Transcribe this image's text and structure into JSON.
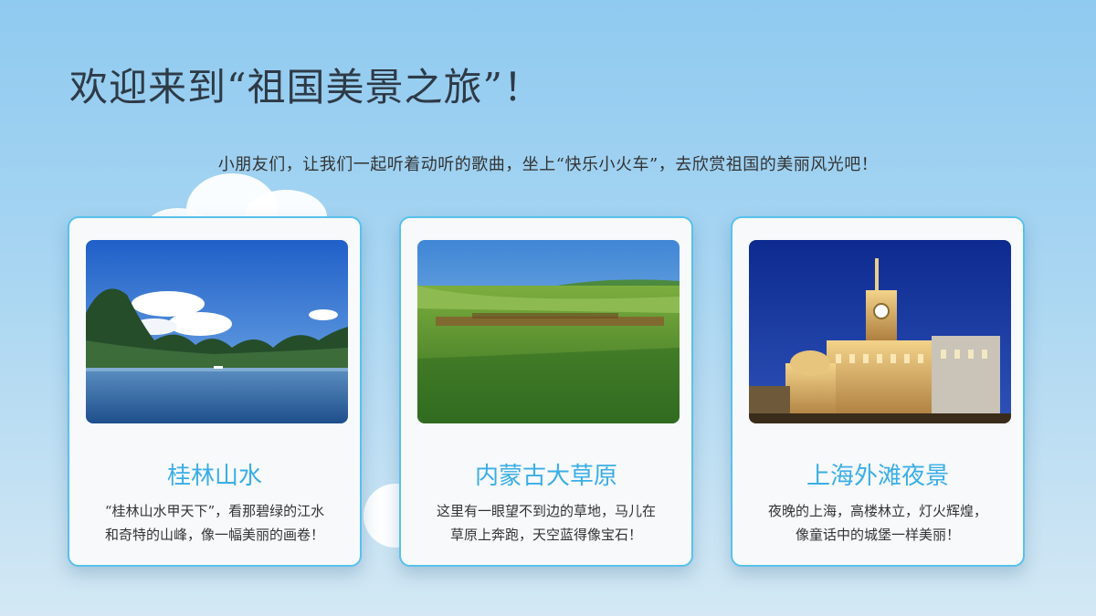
{
  "page": {
    "title": "欢迎来到“祖国美景之旅”！",
    "subtitle": "小朋友们，让我们一起听着动听的歌曲，坐上“快乐小火车”，去欣赏祖国的美丽风光吧！"
  },
  "cards": [
    {
      "title": "桂林山水",
      "lines": [
        "“桂林山水甲天下”，看那碧绿的江水",
        "和奇特的山峰，像一幅美丽的画卷！"
      ],
      "photo": "guilin-river-photo"
    },
    {
      "title": "内蒙古大草原",
      "lines": [
        "这里有一眼望不到边的草地，马儿在",
        "草原上奔跑，天空蓝得像宝石！"
      ],
      "photo": "grassland-photo"
    },
    {
      "title": "上海外滩夜景",
      "lines": [
        "夜晚的上海，高楼林立，灯火辉煌，",
        "像童话中的城堡一样美丽！"
      ],
      "photo": "bund-night-photo"
    }
  ],
  "colors": {
    "background_top": "#8fcaf0",
    "background_bottom": "#d3e8f4",
    "card_border": "#58c1ec",
    "card_title": "#3aaee6",
    "heading": "#2e3a46"
  }
}
